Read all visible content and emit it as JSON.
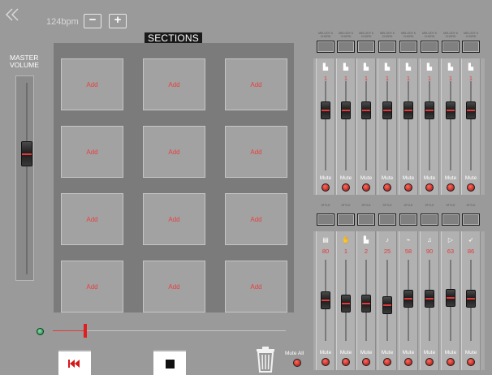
{
  "toolbar": {
    "tempo": "124bpm",
    "minus_label": "−",
    "plus_label": "+",
    "back_icon": "double-chevron-left-icon"
  },
  "sections": {
    "title": "SECTIONS",
    "pads": [
      "Add",
      "Add",
      "Add",
      "Add",
      "Add",
      "Add",
      "Add",
      "Add",
      "Add",
      "Add",
      "Add",
      "Add"
    ]
  },
  "master": {
    "label_line1": "MASTER",
    "label_line2": "VOLUME",
    "level": 0.65
  },
  "transport": {
    "position": 0.14,
    "rewind_icon": "skip-back-icon",
    "stop_icon": "stop-icon"
  },
  "mixer": {
    "mute_all_label": "Mute All",
    "top_group": {
      "header_labels": [
        "MELODY 6 CHORD",
        "MELODY 6 CHORD",
        "MELODY 6 CHORD",
        "MELODY 6 CHORD",
        "MELODY 6 CHORD",
        "MELODY 6 CHORD",
        "MELODY 6 CHORD",
        "MELODY 6 CHORD"
      ],
      "channels": [
        {
          "icon": "piano-icon",
          "value": "1",
          "mute_label": "Mute",
          "level": 0.72
        },
        {
          "icon": "piano-icon",
          "value": "1",
          "mute_label": "Mute",
          "level": 0.72
        },
        {
          "icon": "piano-icon",
          "value": "1",
          "mute_label": "Mute",
          "level": 0.72
        },
        {
          "icon": "piano-icon",
          "value": "1",
          "mute_label": "Mute",
          "level": 0.72
        },
        {
          "icon": "piano-icon",
          "value": "1",
          "mute_label": "Mute",
          "level": 0.72
        },
        {
          "icon": "piano-icon",
          "value": "1",
          "mute_label": "Mute",
          "level": 0.72
        },
        {
          "icon": "piano-icon",
          "value": "1",
          "mute_label": "Mute",
          "level": 0.72
        },
        {
          "icon": "piano-icon",
          "value": "1",
          "mute_label": "Mute",
          "level": 0.72
        }
      ]
    },
    "bottom_group": {
      "header_labels": [
        "STYLE",
        "STYLE",
        "STYLE",
        "STYLE",
        "STYLE",
        "STYLE",
        "STYLE",
        "STYLE"
      ],
      "channels": [
        {
          "icon": "drum-kit-icon",
          "value": "80",
          "mute_label": "Mute",
          "level": 0.5
        },
        {
          "icon": "hand-percussion-icon",
          "value": "1",
          "mute_label": "Mute",
          "level": 0.45
        },
        {
          "icon": "piano-icon",
          "value": "2",
          "mute_label": "Mute",
          "level": 0.45
        },
        {
          "icon": "guitar-icon",
          "value": "25",
          "mute_label": "Mute",
          "level": 0.42
        },
        {
          "icon": "bass-icon",
          "value": "58",
          "mute_label": "Mute",
          "level": 0.52
        },
        {
          "icon": "strings-icon",
          "value": "90",
          "mute_label": "Mute",
          "level": 0.52
        },
        {
          "icon": "horn-icon",
          "value": "63",
          "mute_label": "Mute",
          "level": 0.54
        },
        {
          "icon": "brass-icon",
          "value": "86",
          "mute_label": "Mute",
          "level": 0.52
        }
      ]
    }
  }
}
